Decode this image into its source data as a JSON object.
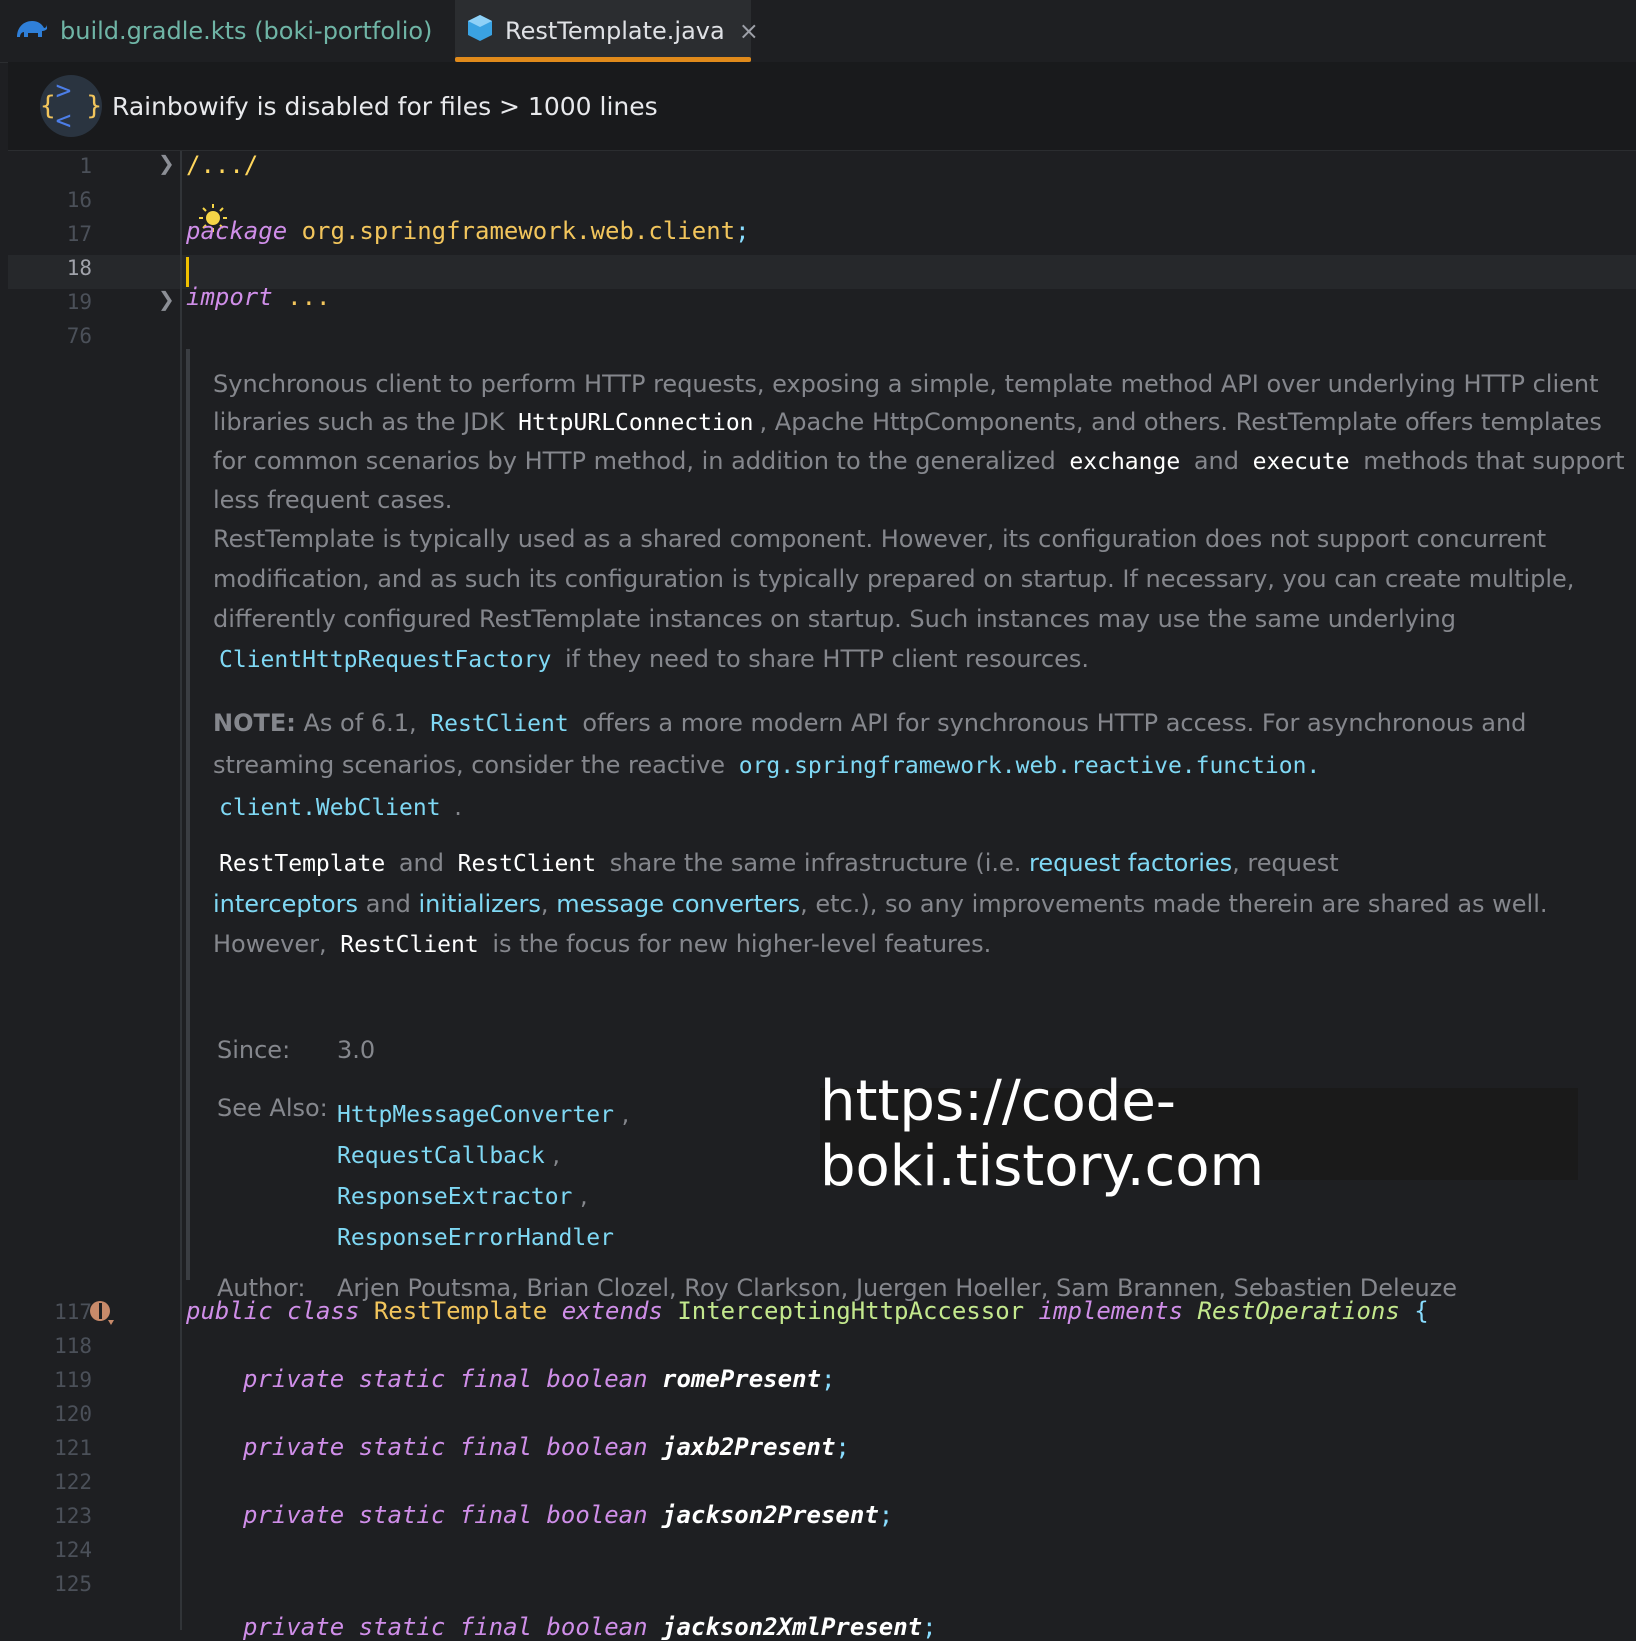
{
  "tabs": [
    {
      "label": "build.gradle.kts (boki-portfolio)",
      "icon": "gradle-elephant-icon",
      "active": false
    },
    {
      "label": "RestTemplate.java",
      "icon": "java-class-icon",
      "active": true,
      "close": "×"
    }
  ],
  "notice": {
    "logo_text": "{><}",
    "text": "Rainbowify is disabled for files > 1000 lines"
  },
  "gutter": {
    "lines": [
      "1",
      "16",
      "17",
      "18",
      "19",
      "76",
      "117",
      "118",
      "119",
      "120",
      "121",
      "122",
      "123",
      "124",
      "125"
    ]
  },
  "code": {
    "l1": "/.../",
    "l17_kw": "package",
    "l17_pkg": "org.springframework.web.client",
    "l17_semi": ";",
    "l19_kw": "import",
    "l19_rest": "...",
    "l117": {
      "kw1": "public",
      "kw2": "class",
      "name": "RestTemplate",
      "kw3": "extends",
      "super": "InterceptingHttpAccessor",
      "kw4": "implements",
      "iface": "RestOperations",
      "brace": "{"
    },
    "mods": "private static final boolean",
    "fields": [
      "romePresent",
      "jaxb2Present",
      "jackson2Present",
      "jackson2XmlPresent"
    ],
    "semi": ";"
  },
  "doc": {
    "p1": {
      "t1": "Synchronous client to perform HTTP requests, exposing a simple, template method API over underlying HTTP client libraries such as the JDK",
      "c1": "HttpURLConnection",
      "t2": ", Apache HttpComponents, and others. RestTemplate offers templates for common scenarios by HTTP method, in addition to the generalized",
      "c2": "exchange",
      "t3": "and",
      "c3": "execute",
      "t4": "methods that support less frequent cases."
    },
    "p2": {
      "t1": "RestTemplate is typically used as a shared component. However, its configuration does not support concurrent modification, and as such its configuration is typically prepared on startup. If necessary, you can create multiple, differently configured RestTemplate instances on startup. Such instances may use the same underlying",
      "l1": "ClientHttpRequestFactory",
      "t2": "if they need to share HTTP client resources."
    },
    "p3": {
      "b1": "NOTE:",
      "t1": "As of 6.1,",
      "l1": "RestClient",
      "t2": "offers a more modern API for synchronous HTTP access. For asynchronous and streaming scenarios, consider the reactive",
      "l2": "org.springframework.web.reactive.function.",
      "l3": "client.WebClient",
      "t3": "."
    },
    "p4": {
      "c1": "RestTemplate",
      "t1": "and",
      "c2": "RestClient",
      "t2": "share the same infrastructure (i.e.",
      "lt1": "request factories",
      "t3": ", request",
      "lt2": "interceptors",
      "t4": "and",
      "lt3": "initializers",
      "t5": ",",
      "lt4": "message converters",
      "t6": ", etc.), so any improvements made therein are shared as well. However,",
      "c3": "RestClient",
      "t7": "is the focus for new higher-level features."
    },
    "since_label": "Since:",
    "since_value": "3.0",
    "see_label": "See Also:",
    "see_items": [
      "HttpMessageConverter",
      "RequestCallback",
      "ResponseExtractor",
      "ResponseErrorHandler"
    ],
    "see_sep": ",",
    "author_label": "Author:",
    "author_value": "Arjen Poutsma, Brian Clozel, Roy Clarkson, Juergen Hoeller, Sam Brannen, Sebastien Deleuze"
  },
  "watermark": "https://code-boki.tistory.com",
  "colors": {
    "accent_tab_underline": "#e08a1b",
    "keyword": "#cf8ee8",
    "link": "#7fd8f4",
    "caret": "#f0c000"
  }
}
